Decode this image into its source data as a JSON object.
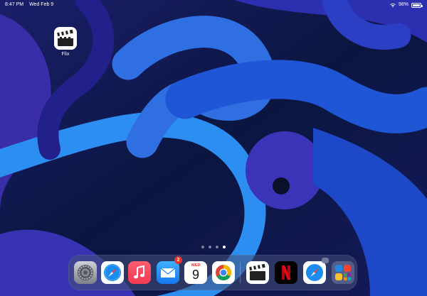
{
  "status_bar": {
    "time": "8:47 PM",
    "date": "Wed Feb 9",
    "battery_percent": "98%",
    "battery_level": 0.98
  },
  "home_apps": [
    {
      "label": "Flix",
      "icon": "clapperboard-icon"
    }
  ],
  "pages": {
    "count": 4,
    "current": 4
  },
  "dock": {
    "apps": [
      {
        "icon": "settings-gear-icon"
      },
      {
        "icon": "safari-compass-icon"
      },
      {
        "icon": "music-note-icon"
      },
      {
        "icon": "mail-envelope-icon",
        "badge": "2"
      },
      {
        "icon": "calendar-icon",
        "day": "WED",
        "date": "9"
      },
      {
        "icon": "chrome-icon"
      }
    ],
    "recent_apps": [
      {
        "icon": "clapperboard-icon"
      },
      {
        "icon": "netflix-icon"
      },
      {
        "icon": "safari-compass-icon"
      },
      {
        "icon": "app-library-icon"
      }
    ]
  },
  "colors": {
    "accent_blue": "#1f6fe0",
    "badge_red": "#e5352c"
  }
}
